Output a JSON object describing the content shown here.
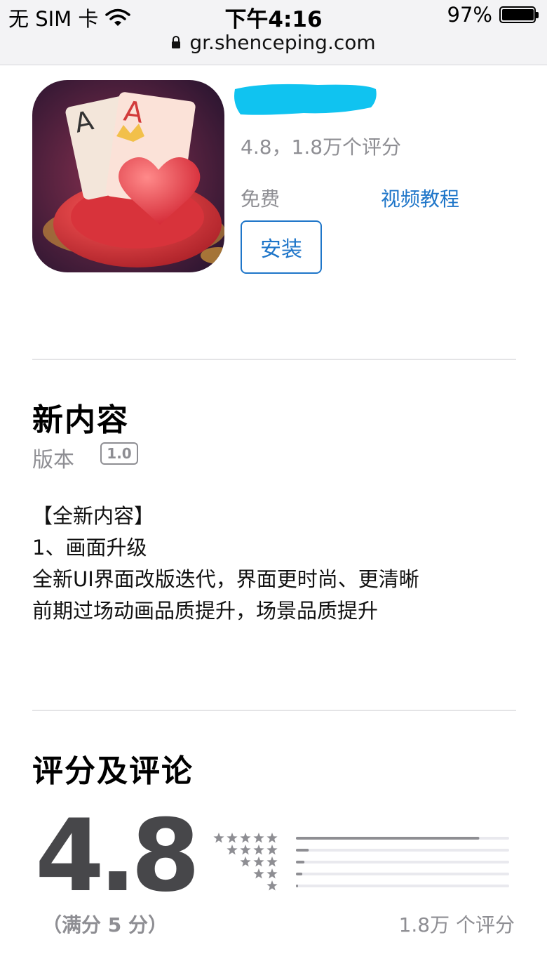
{
  "status_bar": {
    "carrier": "无 SIM 卡",
    "time": "下午4:16",
    "battery": "97%",
    "battery_level": 0.97
  },
  "browser": {
    "url": "gr.shenceping.com"
  },
  "app": {
    "rating_line": "4.8，1.8万个评分",
    "price": "免费",
    "video_tutorial": "视频教程",
    "install_label": "安装",
    "icon_colors": {
      "primary": "#c2262f",
      "background": "#4a1f3a"
    }
  },
  "whats_new": {
    "title": "新内容",
    "version_label": "版本",
    "version": "1.0",
    "notes": [
      "【全新内容】",
      "1、画面升级",
      "全新UI界面改版迭代，界面更时尚、更清晰",
      "前期过场动画品质提升，场景品质提升"
    ]
  },
  "ratings": {
    "title": "评分及评论",
    "score": "4.8",
    "out_of": "（满分 5 分）",
    "count": "1.8万 个评分",
    "distribution": [
      {
        "stars": 5,
        "fraction": 0.86
      },
      {
        "stars": 4,
        "fraction": 0.06
      },
      {
        "stars": 3,
        "fraction": 0.04
      },
      {
        "stars": 2,
        "fraction": 0.03
      },
      {
        "stars": 1,
        "fraction": 0.01
      }
    ]
  },
  "colors": {
    "accent": "#1f76c9",
    "secondary_text": "#8e8e93",
    "redaction": "#10c3f0"
  }
}
